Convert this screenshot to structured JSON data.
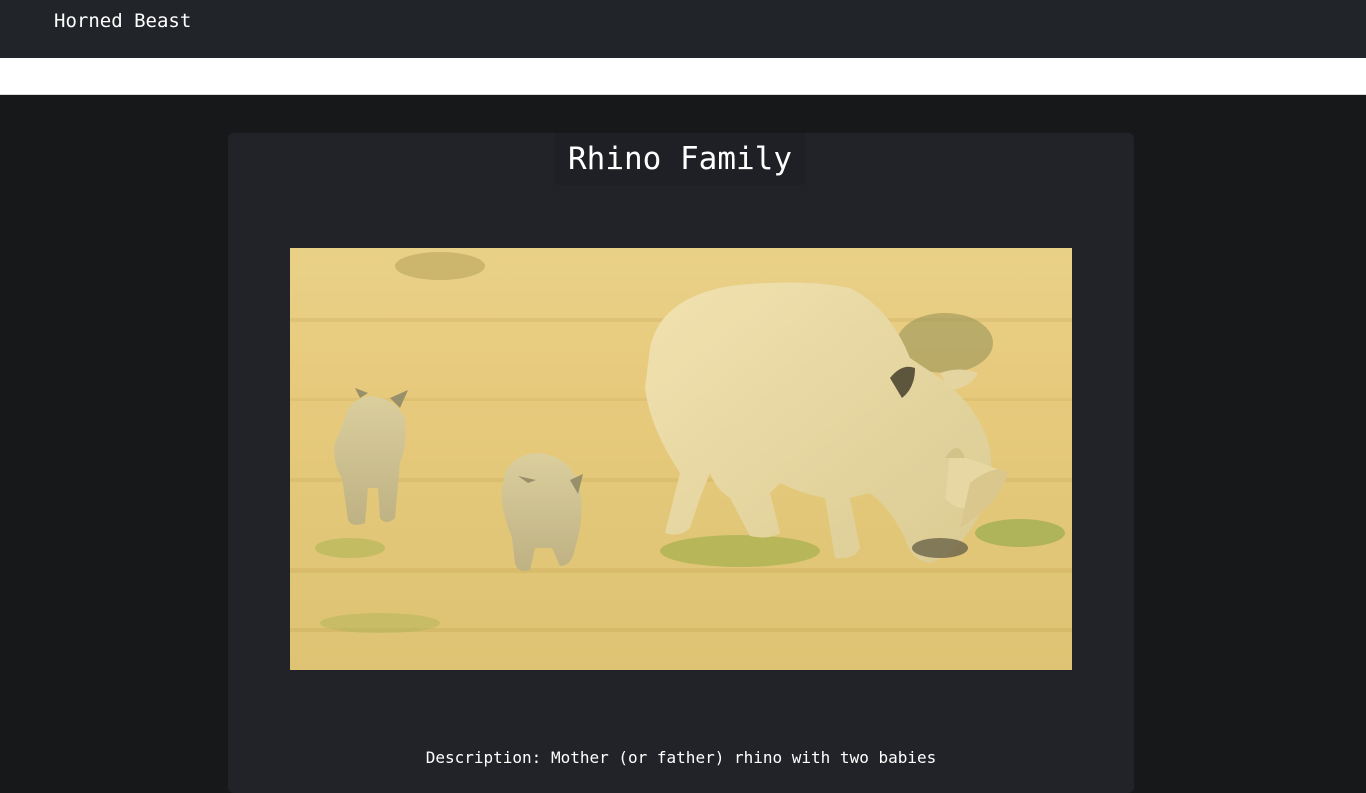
{
  "navbar": {
    "brand": "Horned Beast"
  },
  "card": {
    "title": "Rhino Family",
    "image_alt": "Rhino Family",
    "description": "Description: Mother (or father) rhino with two babies"
  },
  "colors": {
    "navbar_bg": "#212429",
    "page_bg": "#171819",
    "card_bg": "#212328",
    "text": "#ffffff"
  }
}
